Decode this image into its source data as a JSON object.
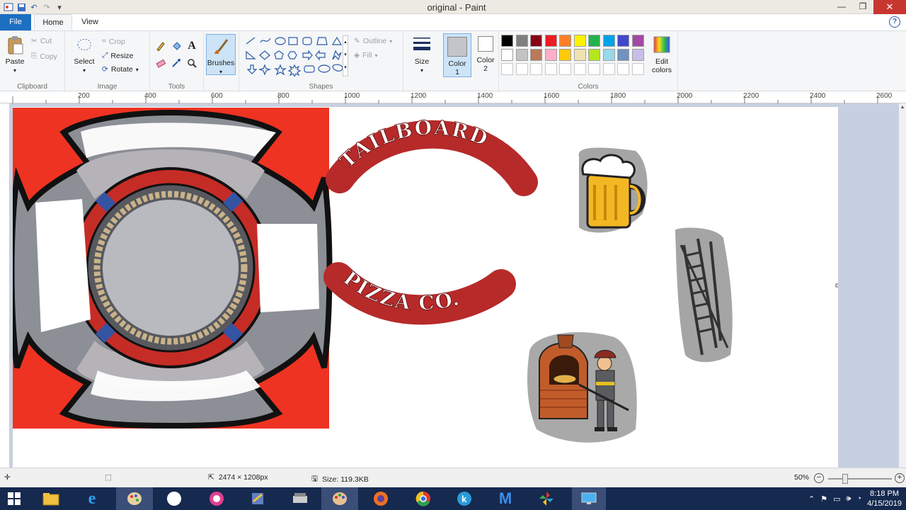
{
  "window": {
    "title": "original - Paint"
  },
  "tabs": {
    "file": "File",
    "home": "Home",
    "view": "View"
  },
  "ribbon": {
    "clipboard": {
      "paste": "Paste",
      "cut": "Cut",
      "copy": "Copy",
      "label": "Clipboard"
    },
    "image": {
      "select": "Select",
      "crop": "Crop",
      "resize": "Resize",
      "rotate": "Rotate",
      "label": "Image"
    },
    "tools": {
      "label": "Tools"
    },
    "brushes": {
      "label": "Brushes"
    },
    "shapes": {
      "outline": "Outline",
      "fill": "Fill",
      "label": "Shapes"
    },
    "size": {
      "label": "Size"
    },
    "color1": {
      "label": "Color",
      "num": "1",
      "value": "#c3c5ca"
    },
    "color2": {
      "label": "Color",
      "num": "2",
      "value": "#ffffff"
    },
    "colors": {
      "label": "Colors",
      "edit": "Edit",
      "edit2": "colors",
      "row1": [
        "#000000",
        "#7f7f7f",
        "#880015",
        "#ed1c24",
        "#ff7f27",
        "#fff200",
        "#22b14c",
        "#00a2e8",
        "#3f48cc",
        "#a349a4"
      ],
      "row2": [
        "#ffffff",
        "#c3c3c3",
        "#b97a57",
        "#ffaec9",
        "#ffc90e",
        "#efe4b0",
        "#b5e61d",
        "#99d9ea",
        "#7092be",
        "#c8bfe7"
      ]
    }
  },
  "ruler": {
    "ticks": [
      "200",
      "400",
      "600",
      "800",
      "1000",
      "1200",
      "1400",
      "1600",
      "1800",
      "2000",
      "2200",
      "2400",
      "2600"
    ]
  },
  "artwork": {
    "text1": "TAILBOARD",
    "text2": "PIZZA CO."
  },
  "status": {
    "dimensions": "2474 × 1208px",
    "size": "Size: 119.3KB",
    "zoom": "50%"
  },
  "taskbar": {
    "time": "8:18 PM",
    "date": "4/15/2019"
  }
}
